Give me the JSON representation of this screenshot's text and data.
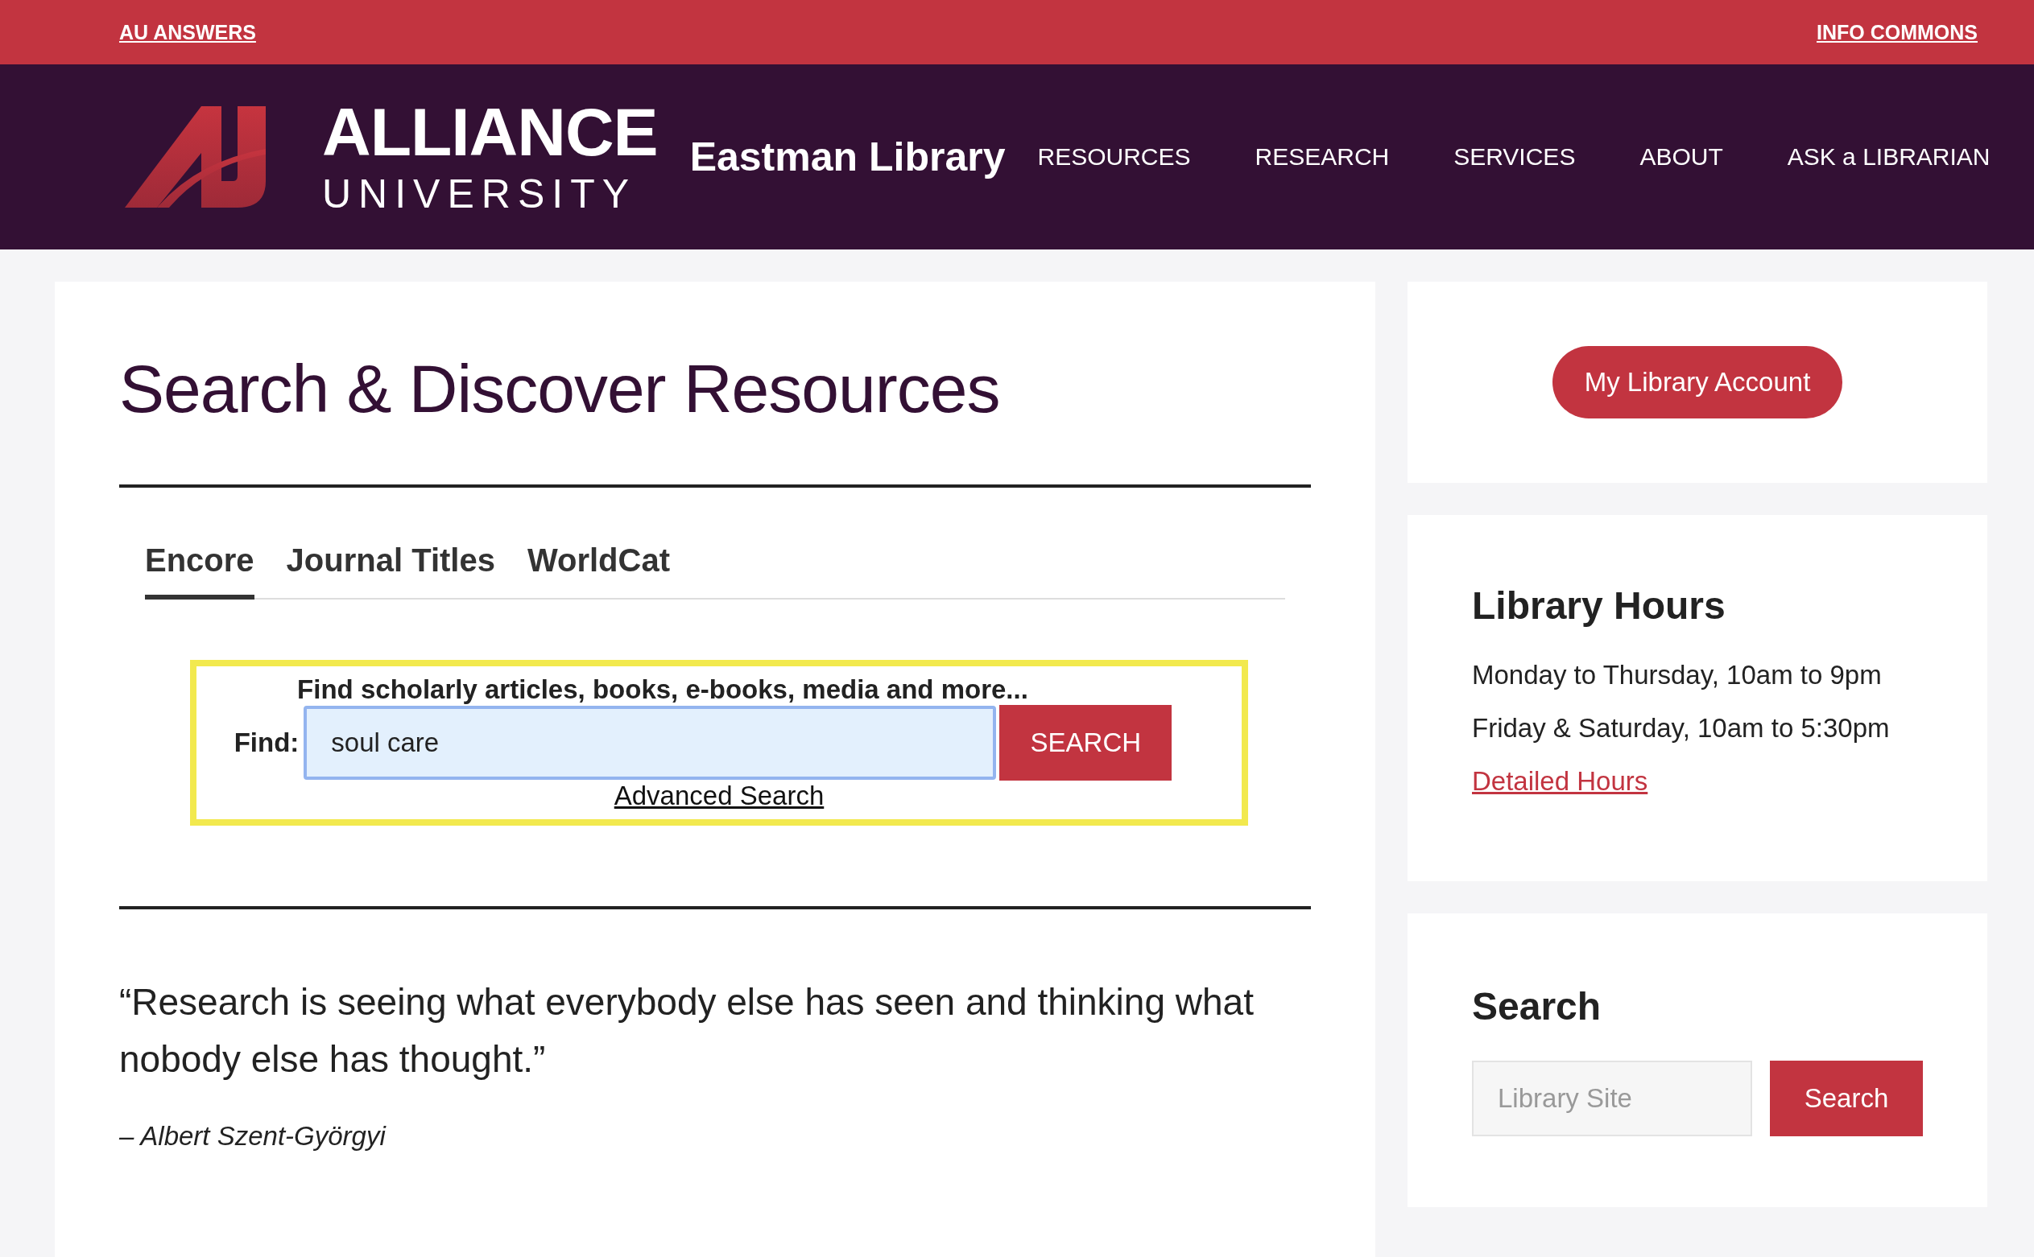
{
  "top_bar": {
    "links": [
      "AU ANSWERS",
      "INFO COMMONS"
    ]
  },
  "header": {
    "logo": {
      "name": "ALLIANCE",
      "subname": "UNIVERSITY"
    },
    "site_title": "Eastman Library",
    "nav": [
      "RESOURCES",
      "RESEARCH",
      "SERVICES",
      "ABOUT",
      "ASK a LIBRARIAN"
    ]
  },
  "main": {
    "title": "Search & Discover Resources",
    "tabs": [
      {
        "label": "Encore",
        "selected": true
      },
      {
        "label": "Journal Titles",
        "selected": false
      },
      {
        "label": "WorldCat",
        "selected": false
      }
    ],
    "search_box": {
      "heading": "Find scholarly articles, books, e-books, media and more...",
      "find_label": "Find:",
      "value": "soul care",
      "button": "SEARCH",
      "advanced_link": "Advanced Search"
    },
    "quote": {
      "text": "“Research is seeing what everybody else has seen and thinking what nobody else has thought.”",
      "author": "– Albert Szent-Györgyi"
    }
  },
  "sidebar": {
    "account_button": "My Library Account",
    "hours": {
      "title": "Library Hours",
      "lines": [
        "Monday to Thursday, 10am to 9pm",
        "Friday & Saturday, 10am to 5:30pm"
      ],
      "link": "Detailed Hours"
    },
    "search": {
      "title": "Search",
      "placeholder": "Library Site",
      "button": "Search"
    }
  }
}
